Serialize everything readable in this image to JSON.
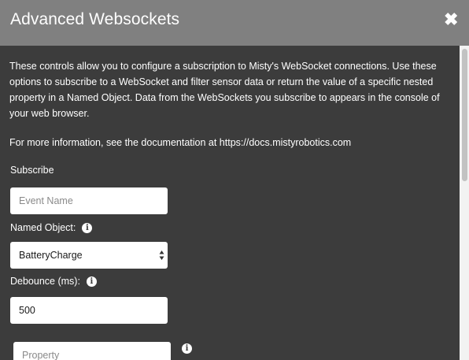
{
  "header": {
    "title": "Advanced Websockets",
    "close_icon": "close-icon"
  },
  "description": "These controls allow you to configure a subscription to Misty's WebSocket connections. Use these options to subscribe to a WebSocket and filter sensor data or return the value of a specific nested property in a Named Object. Data from the WebSockets you subscribe to appears in the console of your web browser.",
  "more_info": "For more information, see the documentation at https://docs.mistyrobotics.com",
  "form": {
    "subscribe_label": "Subscribe",
    "event_name_placeholder": "Event Name",
    "named_object_label": "Named Object:",
    "named_object_value": "BatteryCharge",
    "debounce_label": "Debounce (ms):",
    "debounce_value": "500",
    "property_placeholder": "Property"
  },
  "icons": {
    "info": "info-icon",
    "select": "chevron-up-down-icon"
  },
  "colors": {
    "header_bg": "#808080",
    "body_bg": "#3c3c3c",
    "text": "#ffffff",
    "field_bg": "#ffffff"
  }
}
